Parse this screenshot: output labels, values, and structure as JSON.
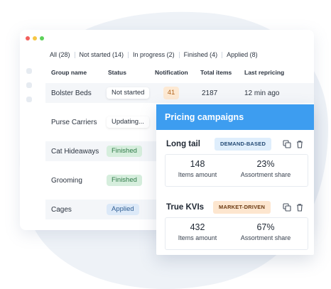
{
  "window": {
    "dots": [
      "#f25f5c",
      "#f6c744",
      "#5dd15a"
    ]
  },
  "filters": [
    {
      "label": "All (28)"
    },
    {
      "label": "Not started (14)"
    },
    {
      "label": "In progress (2)"
    },
    {
      "label": "Finished (4)"
    },
    {
      "label": "Applied (8)"
    }
  ],
  "table": {
    "headers": {
      "group": "Group name",
      "status": "Status",
      "notification": "Notification",
      "total": "Total items",
      "last": "Last repricing"
    },
    "rows": [
      {
        "name": "Bolster Beds",
        "status": "Not started",
        "status_style": "plain",
        "notification": "41",
        "total": "2187",
        "last": "12 min ago"
      },
      {
        "name": "Purse Carriers",
        "status": "Updating...",
        "status_style": "plain"
      },
      {
        "name": "Cat Hideaways",
        "status": "Finished",
        "status_style": "finished"
      },
      {
        "name": "Grooming",
        "status": "Finished",
        "status_style": "finished"
      },
      {
        "name": "Cages",
        "status": "Applied",
        "status_style": "applied"
      }
    ]
  },
  "panel": {
    "title": "Pricing campaigns",
    "campaigns": [
      {
        "name": "Long tail",
        "tag": "DEMAND-BASED",
        "items_value": "148",
        "items_label": "Items amount",
        "share_value": "23%",
        "share_label": "Assortment share"
      },
      {
        "name": "True KVIs",
        "tag": "MARKET-DRIVEN",
        "items_value": "432",
        "items_label": "Items amount",
        "share_value": "67%",
        "share_label": "Assortment share"
      }
    ]
  },
  "icons": {
    "copy": "copy-icon",
    "delete": "trash-icon"
  },
  "colors": {
    "accent": "#3d9df0",
    "background_blob": "#eef2f7"
  }
}
